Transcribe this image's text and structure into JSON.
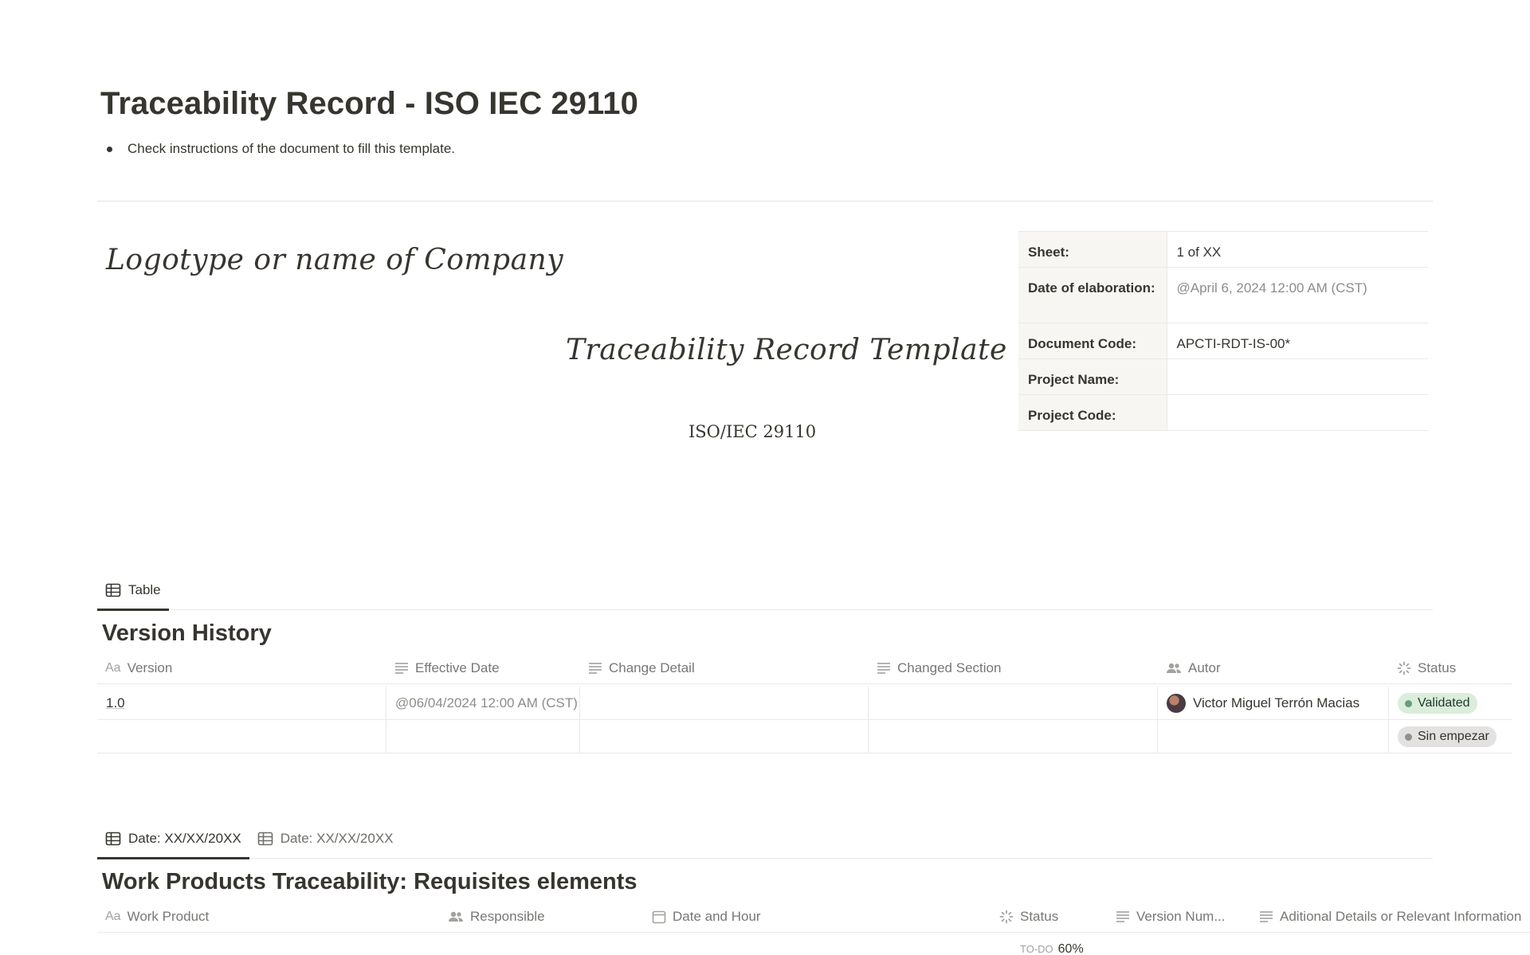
{
  "page": {
    "title": "Traceability Record - ISO IEC 29110",
    "instruction": "Check instructions of the document to fill this template."
  },
  "header": {
    "logo_text": "Logotype or name of Company",
    "template_title": "Traceability Record Template",
    "standard": "ISO/IEC 29110"
  },
  "info_table": [
    {
      "key": "Sheet:",
      "value": ""
    },
    {
      "key": "Date of elaboration:",
      "value": "@April 6, 2024 12:00 AM (CST)"
    },
    {
      "key": "Document Code:",
      "value": "APCTI-RDT-IS-00*"
    },
    {
      "key": "Project Name:",
      "value": ""
    },
    {
      "key": "Project Code:",
      "value": ""
    }
  ],
  "info_sheet_value": "1 of XX",
  "version_history": {
    "tab_label": "Table",
    "title": "Version History",
    "columns": [
      "Version",
      "Effective Date",
      "Change Detail",
      "Changed Section",
      "Autor",
      "Status"
    ],
    "rows": [
      {
        "version": "1.0",
        "effective_date": "@06/04/2024 12:00 AM (CST)",
        "change_detail": "",
        "changed_section": "",
        "autor": "Victor Miguel Terrón Macias",
        "status": "Validated"
      },
      {
        "version": "",
        "effective_date": "",
        "change_detail": "",
        "changed_section": "",
        "autor": "",
        "status": "Sin empezar"
      }
    ]
  },
  "work_products": {
    "tabs": [
      "Date: XX/XX/20XX",
      "Date: XX/XX/20XX"
    ],
    "title": "Work Products Traceability: Requisites elements",
    "columns": [
      "Work Product",
      "Responsible",
      "Date and Hour",
      "Status",
      "Version Num...",
      "Aditional Details or Relevant Information"
    ],
    "peek_status_prefix": "TO-DO",
    "peek_status_value": "60%"
  },
  "colors": {
    "text": "#37352f",
    "muted": "#787774",
    "border": "#e9e9e7",
    "status_validated_bg": "#dbeddb",
    "status_pending_bg": "#e3e2e0"
  }
}
